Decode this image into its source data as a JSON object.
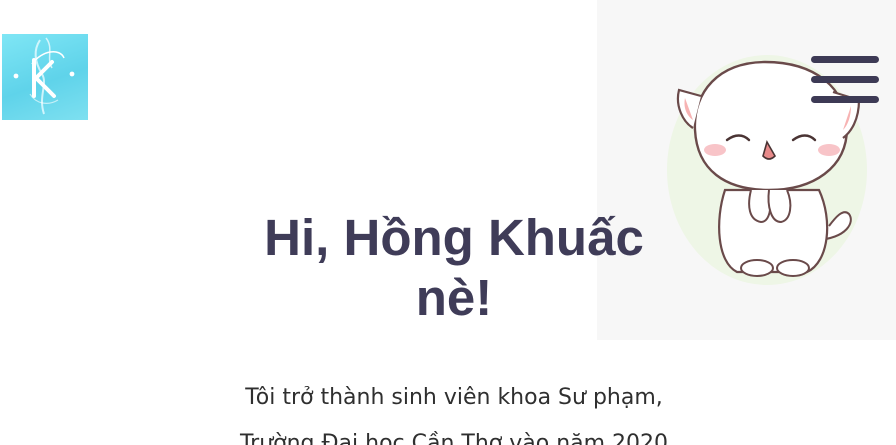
{
  "header": {
    "logo_icon": "k-monogram-logo-icon",
    "menu_icon": "hamburger-menu-icon"
  },
  "hero": {
    "greeting_line1": "Hi, Hồng Khuấc",
    "greeting_line2": "nè!",
    "intro_line1": "Tôi trở thành sinh viên khoa Sư phạm,",
    "intro_line2": "Trường Đại học Cần Thơ vào năm 2020",
    "illustration_icon": "praying-cat-illustration"
  },
  "colors": {
    "heading": "#3f3c58",
    "menu": "#3d3a55",
    "logo_bg": "#6fdcf0"
  }
}
